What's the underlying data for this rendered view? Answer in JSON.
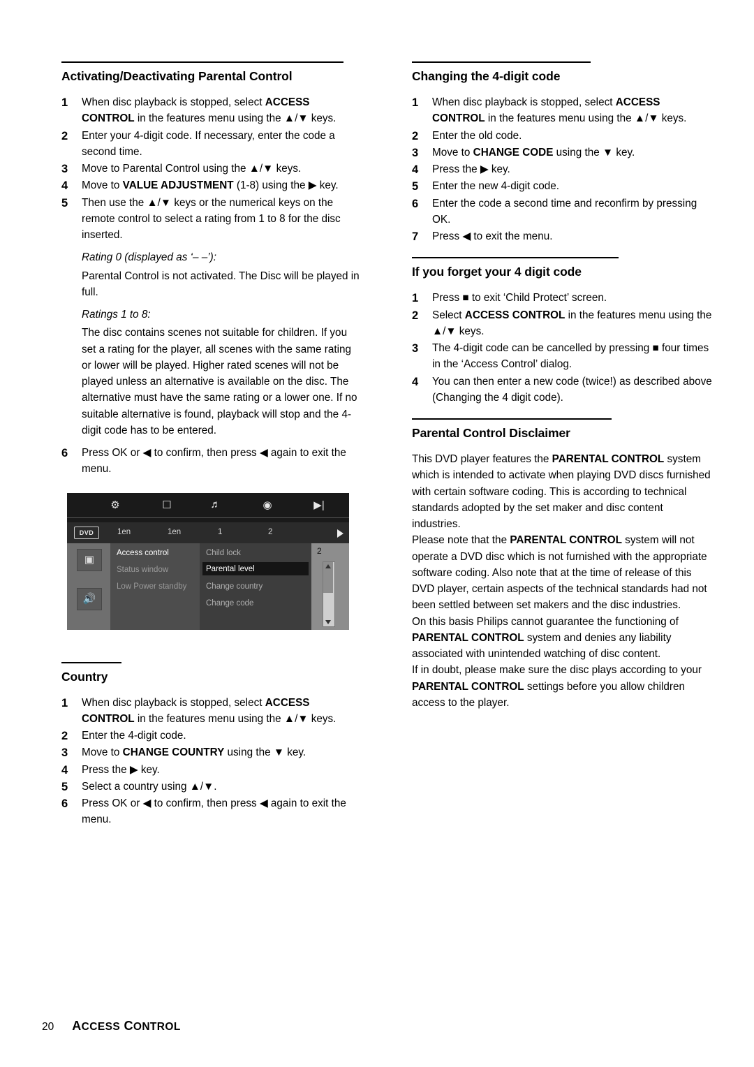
{
  "page": {
    "number": "20",
    "footer_title_parts": [
      "A",
      "CCESS",
      " C",
      "ONTROL"
    ],
    "footer_title": "ACCESS CONTROL"
  },
  "left_column": {
    "sections": [
      {
        "heading": "Activating/Deactivating Parental Control",
        "steps": [
          {
            "num": "1",
            "html": "When disc playback is stopped, select <b>ACCESS CONTROL</b> in the features menu using the ▲/▼ keys."
          },
          {
            "num": "2",
            "html": "Enter your 4-digit code. If necessary, enter the code a second time."
          },
          {
            "num": "3",
            "html": "Move to Parental Control using the ▲/▼ keys."
          },
          {
            "num": "4",
            "html": "Move to <b>VALUE ADJUSTMENT</b> (1-8) using the ▶ key."
          },
          {
            "num": "5",
            "html": "Then use the ▲/▼ keys or the numerical keys on the remote control to select a rating from 1 to 8 for the disc inserted."
          }
        ],
        "note1_italic": "Rating 0 (displayed as ‘– –’):",
        "note1_body": "Parental Control is not activated. The Disc will be played in full.",
        "note2_italic": "Ratings 1 to 8:",
        "note2_body": "The disc contains scenes not suitable for children. If you set a rating for the player, all scenes with the same rating or lower will be played. Higher rated scenes will not be played unless an alternative is available on the disc. The alternative must have the same rating or a lower one. If no suitable alternative is found, playback will stop and the 4-digit code has to be entered.",
        "final_step": {
          "num": "6",
          "html": "Press OK or ◀ to confirm, then press ◀ again to exit the menu."
        }
      },
      {
        "heading": "Country",
        "steps": [
          {
            "num": "1",
            "html": "When disc playback is stopped, select <b>ACCESS CONTROL</b> in the features menu using the ▲/▼ keys."
          },
          {
            "num": "2",
            "html": "Enter the 4-digit code."
          },
          {
            "num": "3",
            "html": "Move to <b>CHANGE COUNTRY</b> using the ▼ key."
          },
          {
            "num": "4",
            "html": "Press the ▶ key."
          },
          {
            "num": "5",
            "html": "Select a country using ▲/▼."
          },
          {
            "num": "6",
            "html": "Press OK or ◀ to confirm, then press ◀ again to exit the menu."
          }
        ]
      }
    ]
  },
  "osd_image": {
    "alt": "DVD on-screen display of Access control menu",
    "dvd_badge": "DVD",
    "top_icons": [
      "settings-icon",
      "subtitle-icon",
      "audio-icon",
      "disc-icon",
      "exit-icon"
    ],
    "sub_labels": [
      "1en",
      "1en",
      "1",
      "2"
    ],
    "left_menu": [
      "Access control",
      "Status window",
      "Low Power standby"
    ],
    "right_menu": [
      "Child lock",
      "Parental level",
      "Change country",
      "Change code"
    ],
    "value": "2",
    "selected_item": "Parental level"
  },
  "right_column": {
    "sections": [
      {
        "heading": "Changing the 4-digit code",
        "steps": [
          {
            "num": "1",
            "html": "When disc playback is stopped, select <b>ACCESS CONTROL</b> in the features menu using the ▲/▼ keys."
          },
          {
            "num": "2",
            "html": "Enter the old code."
          },
          {
            "num": "3",
            "html": "Move to <b>CHANGE CODE</b> using the ▼ key."
          },
          {
            "num": "4",
            "html": "Press the ▶ key."
          },
          {
            "num": "5",
            "html": "Enter the new 4-digit code."
          },
          {
            "num": "6",
            "html": "Enter the code a second time and reconfirm by pressing OK."
          },
          {
            "num": "7",
            "html": "Press ◀ to exit the menu."
          }
        ]
      },
      {
        "heading": "If you forget your 4 digit code",
        "steps": [
          {
            "num": "1",
            "html": "Press ■ to exit ‘Child Protect’ screen."
          },
          {
            "num": "2",
            "html": "Select <b>ACCESS CONTROL</b> in the features menu using the ▲/▼ keys."
          },
          {
            "num": "3",
            "html": "The 4-digit code can be cancelled by pressing ■ four times in the ‘Access Control’ dialog."
          },
          {
            "num": "4",
            "html": "You can then enter a new code (twice!) as described above (Changing the 4 digit code)."
          }
        ]
      },
      {
        "heading": "Parental Control Disclaimer",
        "paragraphs": [
          "This DVD player features the <b>PARENTAL CONTROL</b> system which is intended to activate when playing DVD discs furnished with certain software coding. This is according to technical standards adopted by the set maker and disc content industries.",
          "Please note that the <b>PARENTAL CONTROL</b> system will not operate a DVD disc which is not furnished with the appropriate software coding. Also note that at the time of release of this DVD player, certain aspects of the technical standards had not been settled between set makers and the disc industries.",
          "On this basis Philips cannot guarantee the functioning of <b>PARENTAL CONTROL</b> system and denies any liability associated with unintended watching of disc content.",
          "If in doubt, please make sure the disc plays according to your <b>PARENTAL CONTROL</b> settings before you allow children access to the player."
        ]
      }
    ]
  }
}
